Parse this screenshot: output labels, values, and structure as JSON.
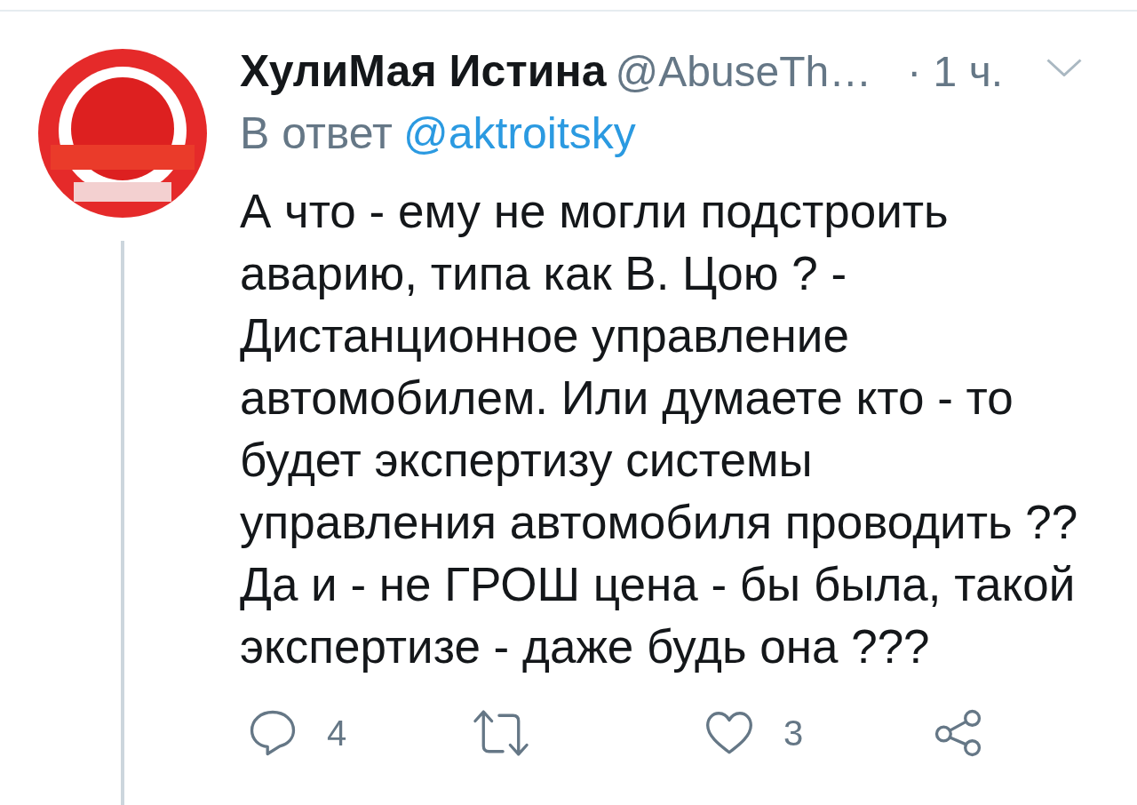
{
  "tweet": {
    "author": {
      "name": "ХулиМая Истина",
      "handle": "@AbuseTh…",
      "time": "· 1 ч."
    },
    "reply_to": {
      "prefix": "В ответ",
      "handle": "@aktroitsky"
    },
    "text": "А что - ему не могли подстроить\nаварию, типа как В. Цою ? -\nДистанционное управление\nавтомобилем. Или думаете кто - то\nбудет экспертизу системы\nуправления автомобиля проводить ??\nДа и - не ГРОШ цена - бы была, такой\nэкспертизе - даже будь она ???",
    "actions": [
      {
        "kind": "reply",
        "count": "4"
      },
      {
        "kind": "retweet"
      },
      {
        "kind": "like",
        "count": "3"
      },
      {
        "kind": "share"
      }
    ]
  }
}
